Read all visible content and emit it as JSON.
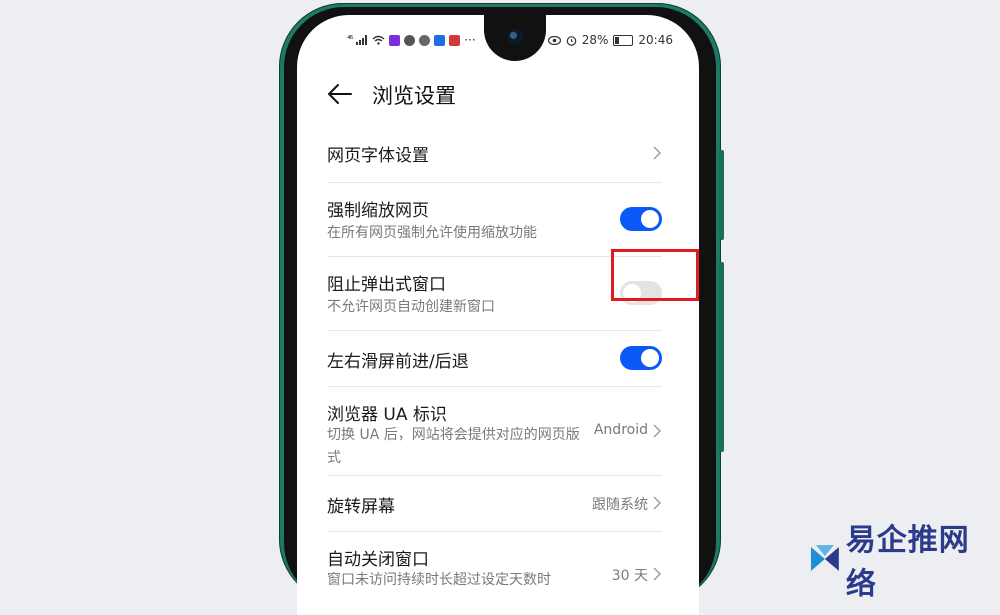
{
  "status_bar": {
    "network": "⁴⁶",
    "dots": "···",
    "battery": "28%",
    "time": "20:46"
  },
  "header": {
    "title": "浏览设置"
  },
  "settings": [
    {
      "title": "网页字体设置",
      "subtitle": "",
      "value": "",
      "control": "chevron"
    },
    {
      "title": "强制缩放网页",
      "subtitle": "在所有网页强制允许使用缩放功能",
      "value": "",
      "control": "toggle",
      "on": true
    },
    {
      "title": "阻止弹出式窗口",
      "subtitle": "不允许网页自动创建新窗口",
      "value": "",
      "control": "toggle",
      "on": false,
      "highlighted": true
    },
    {
      "title": "左右滑屏前进/后退",
      "subtitle": "",
      "value": "",
      "control": "toggle",
      "on": true
    },
    {
      "title": "浏览器 UA 标识",
      "subtitle": "切换 UA 后，网站将会提供对应的网页版式",
      "value": "Android",
      "control": "chevron"
    },
    {
      "title": "旋转屏幕",
      "subtitle": "",
      "value": "跟随系统",
      "control": "chevron"
    },
    {
      "title": "自动关闭窗口",
      "subtitle": "窗口未访问持续时长超过设定天数时",
      "value": "30 天",
      "control": "chevron"
    }
  ],
  "watermark": {
    "text": "易企推网络"
  },
  "colors": {
    "accent": "#0a59f7",
    "highlight": "#e01b22",
    "phone_frame": "#1f7a63"
  }
}
